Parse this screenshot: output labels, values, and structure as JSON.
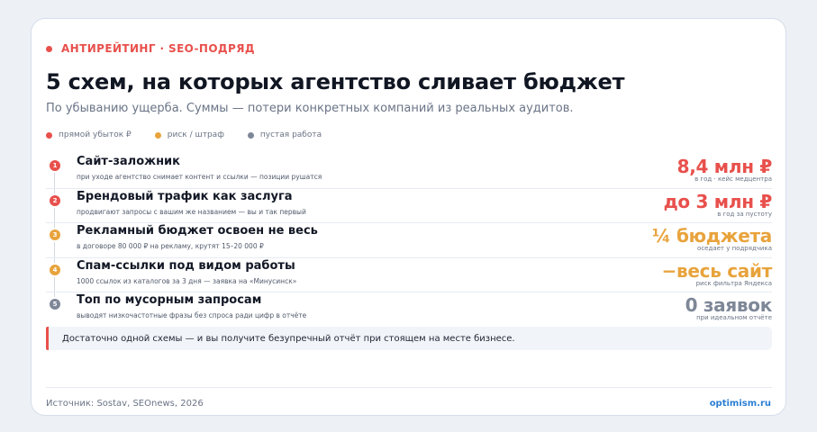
{
  "header": {
    "eyebrow": "АНТИРЕЙТИНГ · SEO-ПОДРЯД",
    "title": "5 схем, на которых агентство сливает бюджет",
    "subtitle": "По убыванию ущерба. Суммы — потери конкретных компаний из реальных аудитов."
  },
  "legend": [
    {
      "label": "прямой убыток ₽",
      "color": "#e8504c"
    },
    {
      "label": "риск / штраф",
      "color": "#e8a33c"
    },
    {
      "label": "пустая работа",
      "color": "#7e8797"
    }
  ],
  "rows": [
    {
      "num": "1",
      "title": "Сайт-заложник",
      "desc": "при уходе агентство снимает контент и ссылки — позиции рушатся",
      "value": "8,4 млн ₽",
      "note": "в год · кейс медцентра",
      "color": "#e8504c"
    },
    {
      "num": "2",
      "title": "Брендовый трафик как заслуга",
      "desc": "продвигают запросы с вашим же названием — вы и так первый",
      "value": "до 3 млн ₽",
      "note": "в год за пустоту",
      "color": "#e8504c"
    },
    {
      "num": "3",
      "title": "Рекламный бюджет освоен не весь",
      "desc": "в договоре 80 000 ₽ на рекламу, крутят 15–20 000 ₽",
      "value": "¼ бюджета",
      "note": "оседает у подрядчика",
      "color": "#e8a33c"
    },
    {
      "num": "4",
      "title": "Спам-ссылки под видом работы",
      "desc": "1000 ссылок из каталогов за 3 дня — заявка на «Минусинск»",
      "value": "−весь сайт",
      "note": "риск фильтра Яндекса",
      "color": "#e8a33c"
    },
    {
      "num": "5",
      "title": "Топ по мусорным запросам",
      "desc": "выводят низкочастотные фразы без спроса ради цифр в отчёте",
      "value": "0 заявок",
      "note": "при идеальном отчёте",
      "color": "#7e8797"
    }
  ],
  "callout": "Достаточно одной схемы — и вы получите безупречный отчёт при стоящем на месте бизнесе.",
  "footer": {
    "source": "Источник: Sostav, SEOnews, 2026",
    "site": "optimism.ru"
  }
}
